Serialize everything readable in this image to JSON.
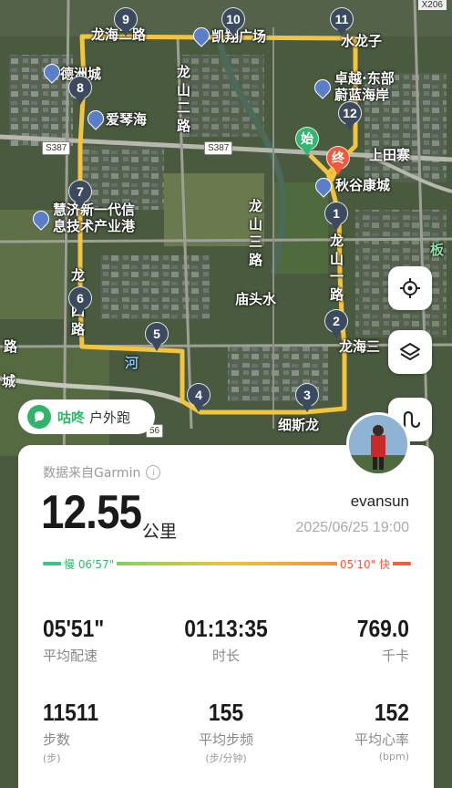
{
  "map": {
    "corner_tag": "X206",
    "route_color": "#f2c440",
    "markers": [
      {
        "label": "9"
      },
      {
        "label": "10"
      },
      {
        "label": "11"
      },
      {
        "label": "8"
      },
      {
        "label": "12"
      },
      {
        "label": "7"
      },
      {
        "label": "1"
      },
      {
        "label": "6"
      },
      {
        "label": "2"
      },
      {
        "label": "5"
      },
      {
        "label": "4"
      },
      {
        "label": "3"
      }
    ],
    "start_label": "始",
    "end_label": "终",
    "places": {
      "road_north": "龙海二路",
      "plaza": "凯翔广场",
      "water_dragon": "水龙子",
      "dezhou_city": "德洲城",
      "zhuoyue_a": "卓越·东部",
      "zhuoyue_b": "蔚蓝海岸",
      "aiqinhai": "爱琴海",
      "shangtianzhai": "上田寨",
      "qiugu": "秋谷康城",
      "huiji_a": "慧济新一代信",
      "huiji_b": "息技术产业港",
      "longshan_er": "龙山二路",
      "longshan_san": "龙山三路",
      "longshan_si": "龙山四路",
      "longshan_yi": "龙山一路",
      "toutoushui": "庙头水",
      "longhai_san": "龙海三",
      "xisilong": "细斯龙",
      "he": "河",
      "lu_left": "路",
      "cheng_left": "城",
      "ban": "板",
      "s387_a": "S387",
      "s387_b": "S387",
      "road_56": "56"
    }
  },
  "badge": {
    "brand": "咕咚",
    "activity": "户外跑"
  },
  "card": {
    "source": "数据来自Garmin",
    "info_symbol": "i",
    "distance": "12.55",
    "distance_unit": "公里",
    "username": "evansun",
    "datetime": "2025/06/25 19:00",
    "pace_slow": "慢 06'57\"",
    "pace_fast": "05'10\" 快",
    "stats": [
      {
        "value": "05'51\"",
        "label": "平均配速",
        "sub": ""
      },
      {
        "value": "01:13:35",
        "label": "时长",
        "sub": ""
      },
      {
        "value": "769.0",
        "label": "千卡",
        "sub": ""
      },
      {
        "value": "11511",
        "label": "步数",
        "sub": "(步)"
      },
      {
        "value": "155",
        "label": "平均步频",
        "sub": "(步/分钟)"
      },
      {
        "value": "152",
        "label": "平均心率",
        "sub": "(bpm)"
      }
    ]
  }
}
